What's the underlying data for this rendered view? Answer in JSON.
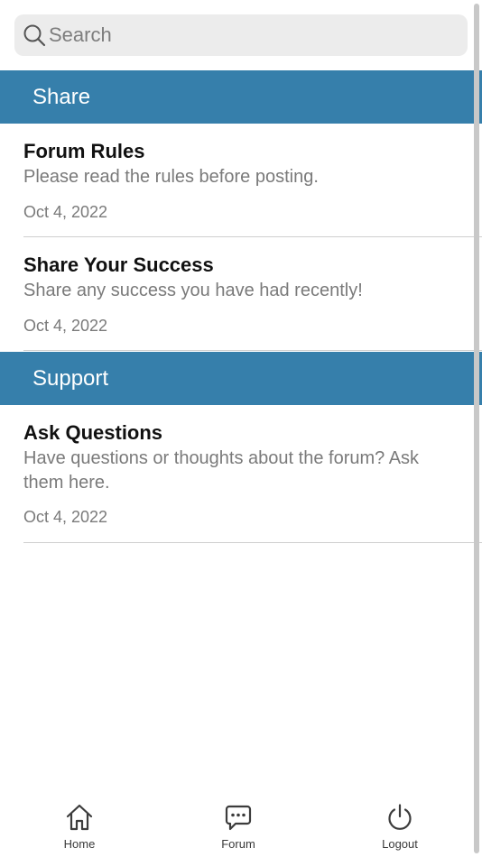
{
  "search": {
    "placeholder": "Search",
    "icon": "search-icon"
  },
  "sections": [
    {
      "label": "Share",
      "topics": [
        {
          "title": "Forum Rules",
          "description": "Please read the rules before posting.",
          "date": "Oct 4, 2022"
        },
        {
          "title": "Share Your Success",
          "description": "Share any success you have had recently!",
          "date": "Oct 4, 2022"
        }
      ]
    },
    {
      "label": "Support",
      "topics": [
        {
          "title": "Ask Questions",
          "description": "Have questions or thoughts about the forum? Ask them here.",
          "date": "Oct 4, 2022"
        }
      ]
    }
  ],
  "bottom_nav": {
    "items": [
      {
        "label": "Home",
        "icon": "home-icon"
      },
      {
        "label": "Forum",
        "icon": "chat-bubble-icon"
      },
      {
        "label": "Logout",
        "icon": "power-icon"
      }
    ]
  },
  "colors": {
    "section_header_bg": "#367fab",
    "search_bg": "#ececec",
    "muted_text": "#7a7a7a",
    "divider": "#cfcfcf"
  }
}
